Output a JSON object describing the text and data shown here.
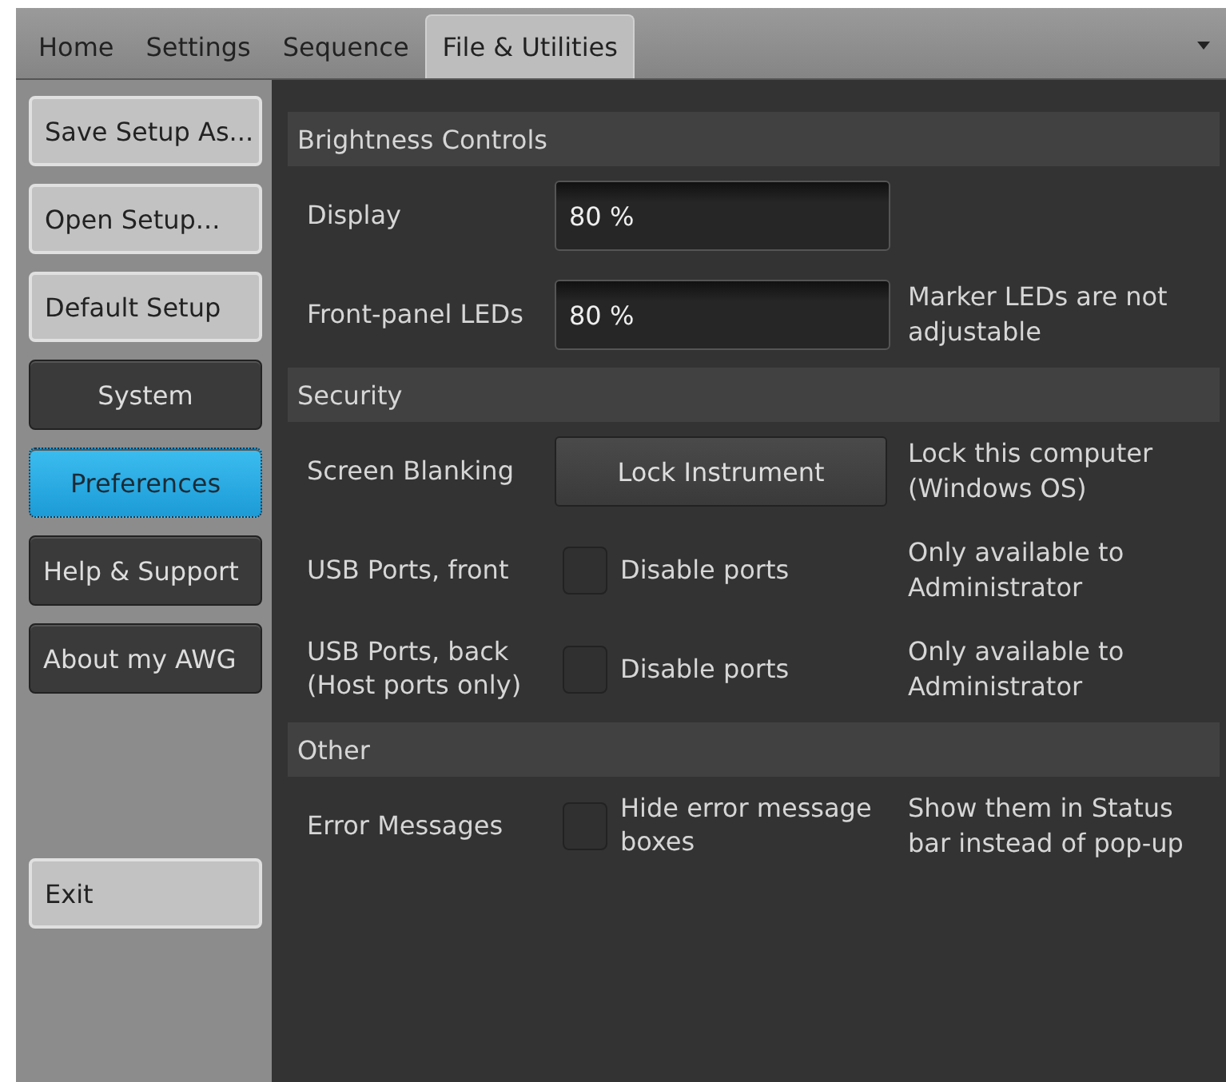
{
  "tabs": [
    {
      "label": "Home",
      "selected": false
    },
    {
      "label": "Settings",
      "selected": false
    },
    {
      "label": "Sequence",
      "selected": false
    },
    {
      "label": "File & Utilities",
      "selected": true
    }
  ],
  "sidebar": {
    "items": [
      {
        "label": "Save Setup As...",
        "kind": "light",
        "selected": false
      },
      {
        "label": "Open Setup...",
        "kind": "light",
        "selected": false
      },
      {
        "label": "Default Setup",
        "kind": "light",
        "selected": false
      },
      {
        "label": "System",
        "kind": "dark",
        "selected": false
      },
      {
        "label": "Preferences",
        "kind": "dark",
        "selected": true
      },
      {
        "label": "Help & Support",
        "kind": "dark",
        "selected": false
      },
      {
        "label": "About my AWG",
        "kind": "dark",
        "selected": false
      }
    ],
    "footer": [
      {
        "label": "Exit",
        "kind": "light",
        "selected": false
      }
    ]
  },
  "sections": [
    {
      "title": "Brightness Controls",
      "rows": [
        {
          "kind": "field",
          "label": "Display",
          "value": "80 %"
        },
        {
          "kind": "field",
          "label": "Front-panel LEDs",
          "value": "80 %",
          "note": "Marker LEDs are not adjustable"
        }
      ]
    },
    {
      "title": "Security",
      "rows": [
        {
          "kind": "button",
          "label": "Screen Blanking",
          "text": "Lock Instrument",
          "note": "Lock this computer (Windows OS)"
        },
        {
          "kind": "checkbox",
          "label": "USB Ports, front",
          "text": "Disable ports",
          "checked": false,
          "note": "Only available to Administrator"
        },
        {
          "kind": "checkbox",
          "label": "USB Ports, back (Host ports only)",
          "text": "Disable ports",
          "checked": false,
          "note": "Only available to Administrator"
        }
      ]
    },
    {
      "title": "Other",
      "rows": [
        {
          "kind": "checkbox",
          "label": "Error Messages",
          "text": "Hide error message boxes",
          "checked": false,
          "note": "Show them in Status bar instead of pop-up"
        }
      ]
    }
  ]
}
